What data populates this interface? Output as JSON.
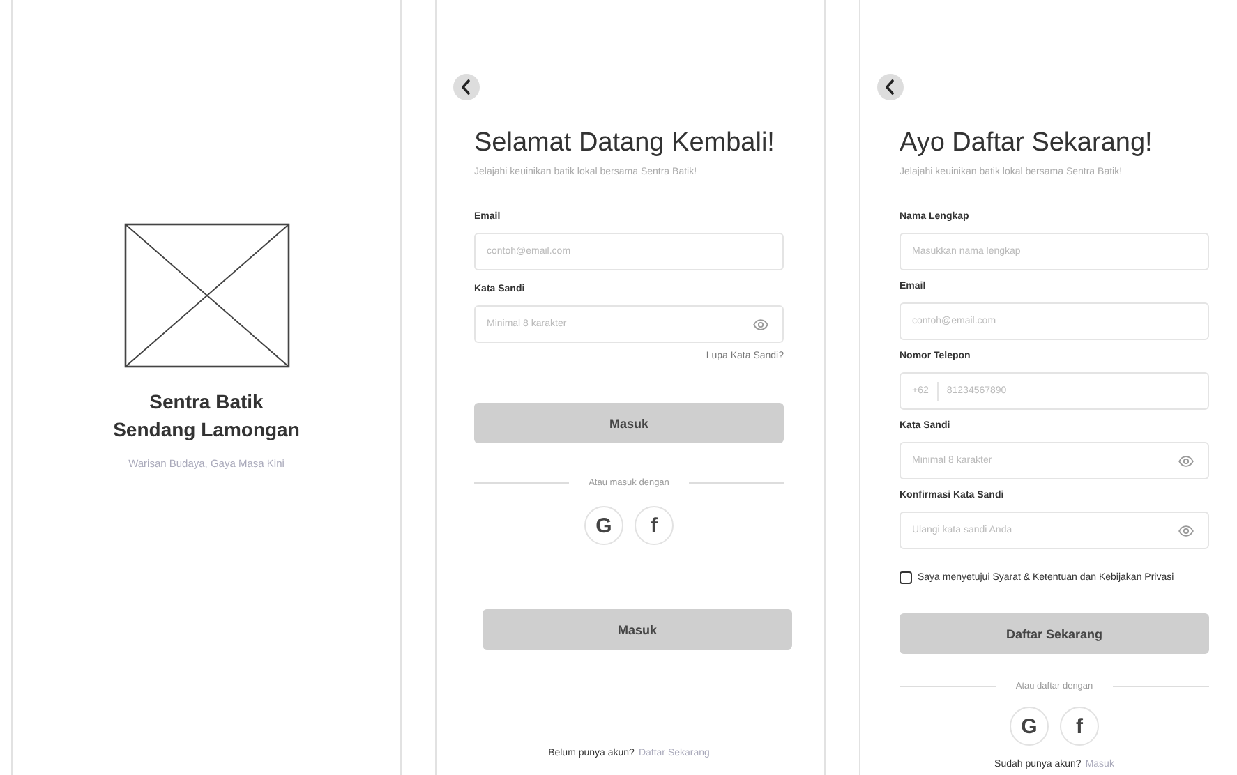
{
  "screens": [
    {
      "kind": "splash",
      "title": "Sentra Batik Sendang Lamongan",
      "tagline": "Warisan Budaya, Gaya Masa Kini"
    },
    {
      "kind": "login",
      "title": "Selamat Datang Kembali!",
      "subtitle": "Jelajahi keuinikan batik lokal bersama Sentra Batik!",
      "fields": [
        {
          "kind": "text",
          "label": "Email",
          "placeholder": "contoh@email.com"
        },
        {
          "kind": "password",
          "label": "Kata Sandi",
          "placeholder": "Minimal 8 karakter"
        }
      ],
      "forgot_link": "Lupa Kata Sandi?",
      "primary_button": "Masuk",
      "divider": "Atau masuk dengan",
      "social": [
        "G",
        "f"
      ],
      "secondary_button": "Masuk",
      "footer": {
        "question": "Belum punya akun?",
        "link": "Daftar Sekarang"
      }
    },
    {
      "kind": "register",
      "title": "Ayo Daftar Sekarang!",
      "subtitle": "Jelajahi keuinikan batik lokal bersama Sentra Batik!",
      "fields": [
        {
          "kind": "text",
          "label": "Nama Lengkap",
          "placeholder": "Masukkan nama lengkap"
        },
        {
          "kind": "text",
          "label": "Email",
          "placeholder": "contoh@email.com"
        },
        {
          "kind": "phone",
          "label": "Nomor Telepon",
          "prefix": "+62",
          "placeholder": "81234567890"
        },
        {
          "kind": "password",
          "label": "Kata Sandi",
          "placeholder": "Minimal 8 karakter"
        },
        {
          "kind": "password",
          "label": "Konfirmasi Kata Sandi",
          "placeholder": "Ulangi kata sandi Anda"
        }
      ],
      "agreement": {
        "text": "Saya menyetujui Syarat & Ketentuan dan Kebijakan Privasi",
        "checked": false
      },
      "primary_button": "Daftar Sekarang",
      "divider": "Atau daftar dengan",
      "social": [
        "G",
        "f"
      ],
      "footer": {
        "question": "Sudah punya akun?",
        "link": "Masuk"
      }
    }
  ]
}
